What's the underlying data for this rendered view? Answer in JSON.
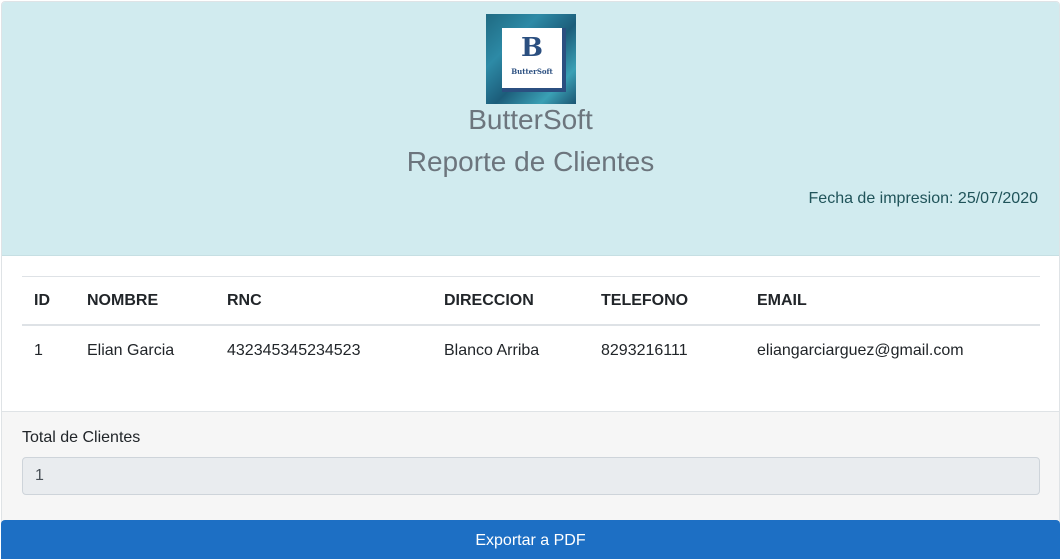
{
  "header": {
    "logo": {
      "letter": "B",
      "word": "ButterSoft"
    },
    "company": "ButterSoft",
    "report_title": "Reporte de Clientes",
    "print_date": "Fecha de impresion: 25/07/2020"
  },
  "table": {
    "columns": [
      "ID",
      "NOMBRE",
      "RNC",
      "DIRECCION",
      "TELEFONO",
      "EMAIL"
    ],
    "rows": [
      [
        "1",
        "Elian Garcia",
        "432345345234523",
        "Blanco Arriba",
        "8293216111",
        "eliangarciarguez@gmail.com"
      ]
    ]
  },
  "footer": {
    "total_label": "Total de Clientes",
    "total_value": "1"
  },
  "export_button": "Exportar a PDF",
  "colors": {
    "header_bg": "#d1ebef",
    "button_bg": "#1d6fc4",
    "logo_navy": "#2b4f80"
  }
}
